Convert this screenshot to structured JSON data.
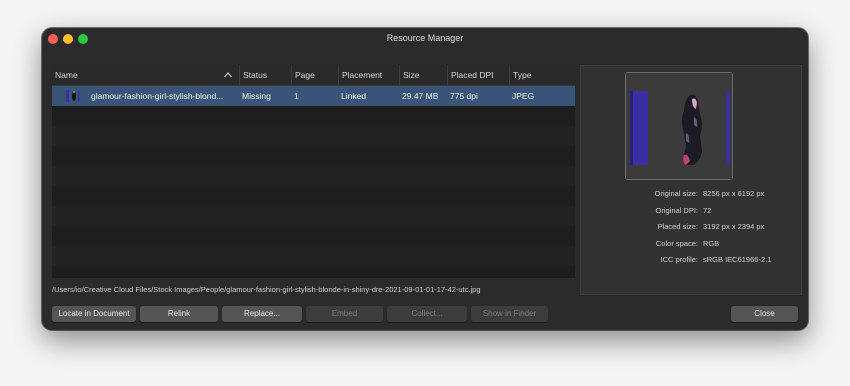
{
  "window": {
    "title": "Resource Manager"
  },
  "table": {
    "columns": [
      {
        "key": "name",
        "label": "Name"
      },
      {
        "key": "status",
        "label": "Status"
      },
      {
        "key": "page",
        "label": "Page"
      },
      {
        "key": "placement",
        "label": "Placement"
      },
      {
        "key": "size",
        "label": "Size"
      },
      {
        "key": "dpi",
        "label": "Placed DPI"
      },
      {
        "key": "type",
        "label": "Type"
      }
    ],
    "rows": [
      {
        "name": "glamour-fashion-girl-stylish-blond...",
        "status": "Missing",
        "page": "1",
        "placement": "Linked",
        "size": "29.47 MB",
        "dpi": "775 dpi",
        "type": "JPEG",
        "selected": true
      }
    ]
  },
  "path": "/Users/io/Creative Cloud Files/Stock Images/People/glamour-fashion-girl-stylish-blonde-in-shiny-dre-2021-09-01-01-17-42-utc.jpg",
  "info": {
    "original_size": {
      "label": "Original size:",
      "value": "8256 px x 6192 px"
    },
    "original_dpi": {
      "label": "Original DPI:",
      "value": "72"
    },
    "placed_size": {
      "label": "Placed size:",
      "value": "3192 px x 2394 px"
    },
    "color_space": {
      "label": "Color space:",
      "value": "RGB"
    },
    "icc_profile": {
      "label": "ICC profile:",
      "value": "sRGB IEC61966-2.1"
    }
  },
  "buttons": {
    "locate": {
      "label": "Locate in Document",
      "enabled": true
    },
    "relink": {
      "label": "Relink",
      "enabled": true
    },
    "replace": {
      "label": "Replace...",
      "enabled": true
    },
    "embed": {
      "label": "Embed",
      "enabled": false
    },
    "collect": {
      "label": "Collect...",
      "enabled": false
    },
    "show_finder": {
      "label": "Show in Finder",
      "enabled": false
    },
    "close": {
      "label": "Close",
      "enabled": true
    }
  },
  "colors": {
    "window_bg": "#2b2b2b",
    "selection": "#3a5478",
    "close_light": "#fe5f57",
    "minimize_light": "#febc2e",
    "zoom_light": "#28c840",
    "thumb_blue": "#3a2fa0"
  },
  "icons": [
    "close-window-icon",
    "minimize-window-icon",
    "zoom-window-icon",
    "sort-ascending-icon",
    "image-thumbnail-icon",
    "image-preview"
  ]
}
